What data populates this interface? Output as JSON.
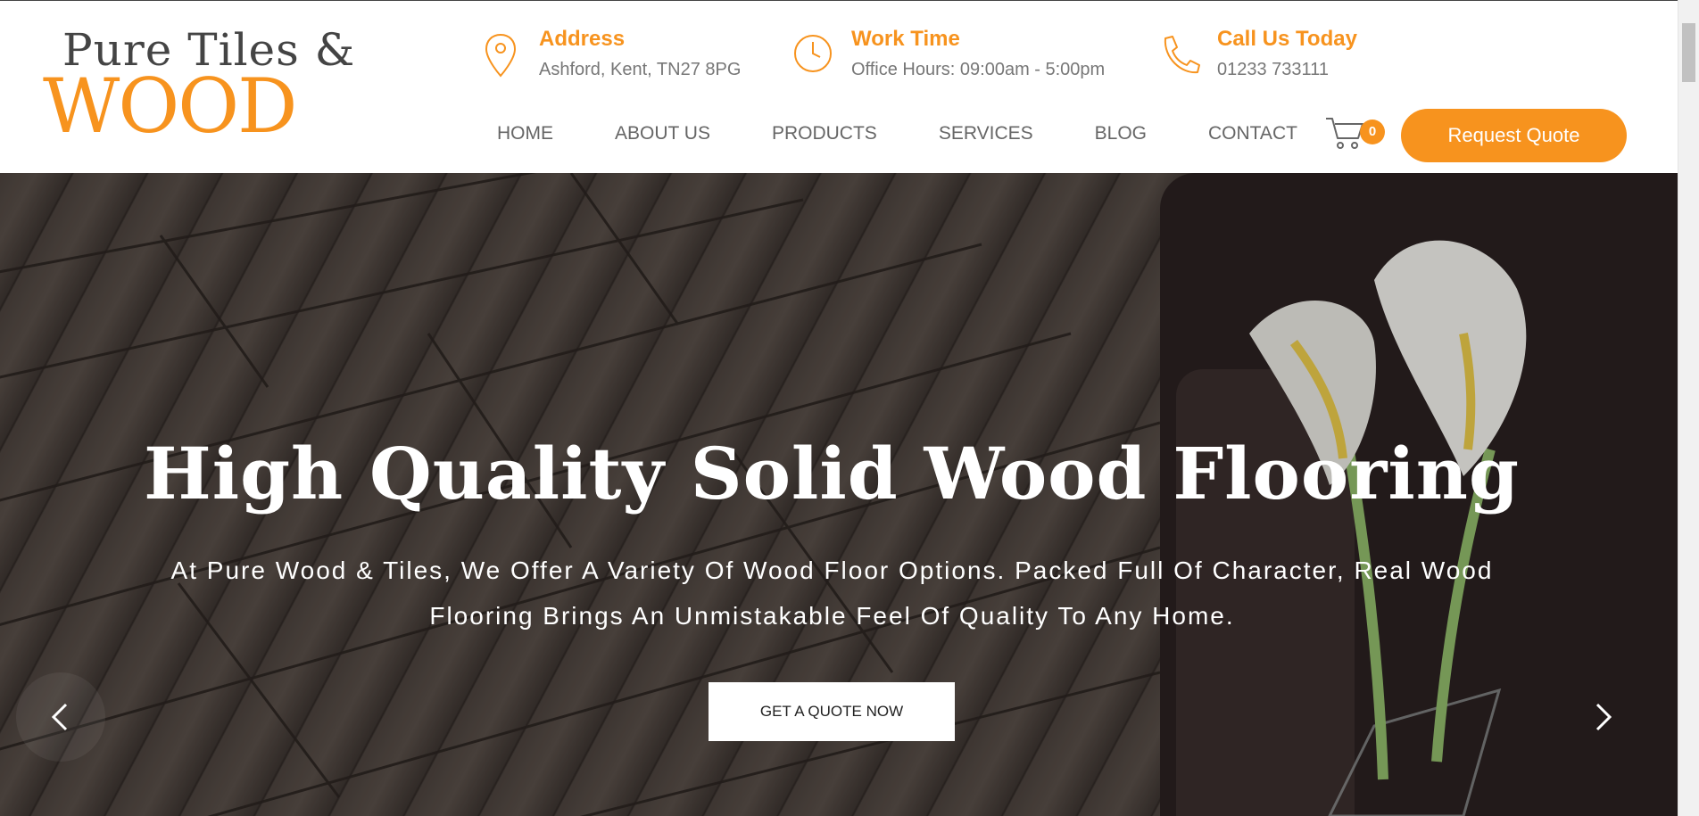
{
  "brand": {
    "logo_top": "Pure Tiles &",
    "logo_bottom": "WOOD",
    "accent": "#f7931e"
  },
  "contact_info": [
    {
      "icon": "map-pin-icon",
      "title": "Address",
      "value": "Ashford, Kent, TN27 8PG"
    },
    {
      "icon": "clock-icon",
      "title": "Work Time",
      "value": "Office Hours: 09:00am - 5:00pm"
    },
    {
      "icon": "phone-icon",
      "title": "Call Us Today",
      "value": "01233 733111"
    }
  ],
  "nav": {
    "items": [
      "HOME",
      "ABOUT US",
      "PRODUCTS",
      "SERVICES",
      "BLOG",
      "CONTACT"
    ],
    "cart_count": "0",
    "quote_label": "Request Quote"
  },
  "hero": {
    "title": "High Quality Solid Wood Flooring",
    "subtitle": "At Pure Wood & Tiles, We Offer A Variety Of Wood Floor Options. Packed Full Of Character, Real Wood Flooring Brings An Unmistakable Feel Of Quality To Any Home.",
    "cta_label": "GET A QUOTE NOW",
    "prev_icon": "chevron-left-icon",
    "next_icon": "chevron-right-icon"
  }
}
